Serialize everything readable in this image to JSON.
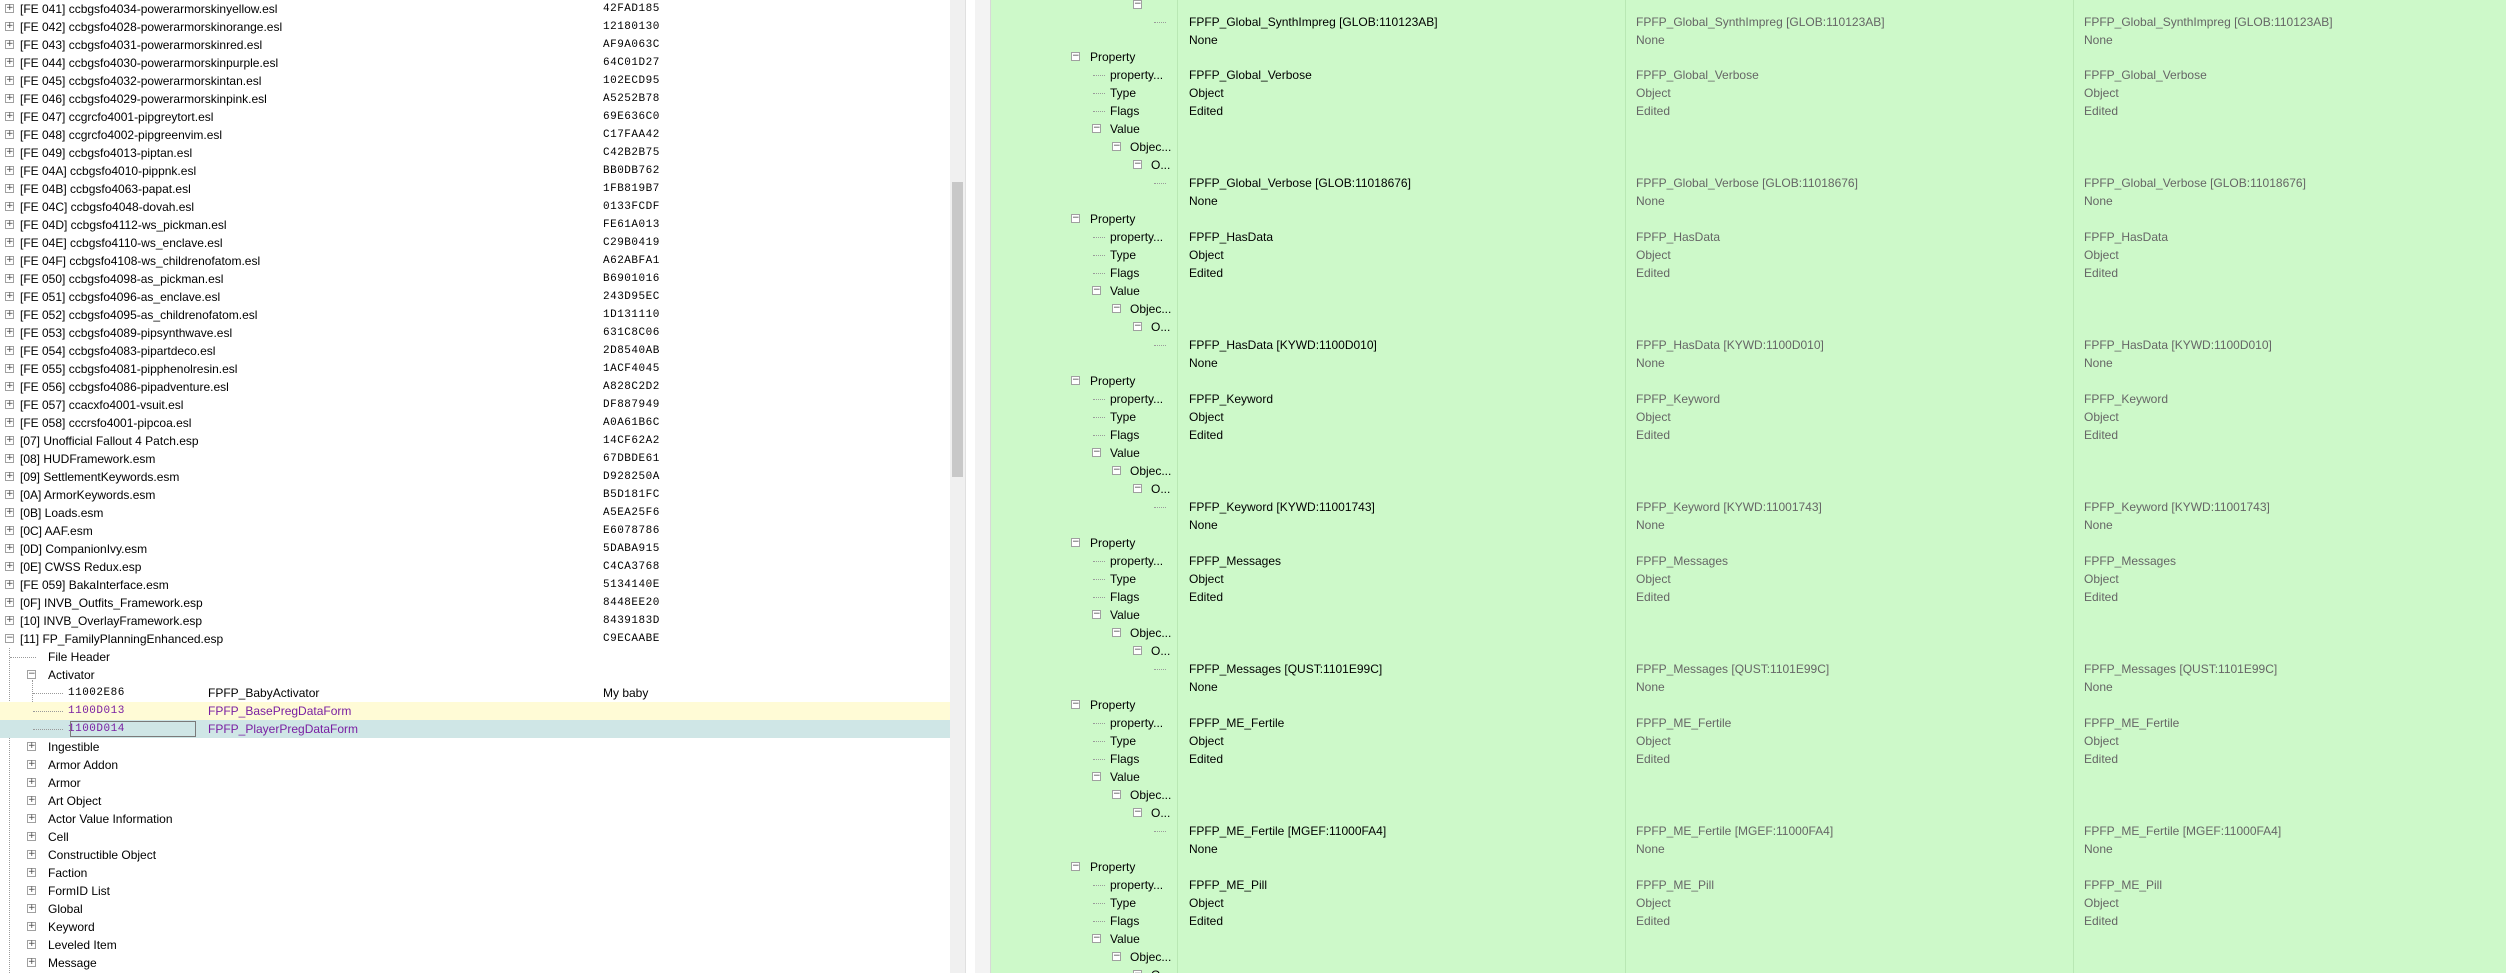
{
  "left_tree": {
    "plugins": [
      {
        "name": "[FE 041] ccbgsfo4034-powerarmorskinyellow.esl",
        "crc": "42FAD185"
      },
      {
        "name": "[FE 042] ccbgsfo4028-powerarmorskinorange.esl",
        "crc": "12180130"
      },
      {
        "name": "[FE 043] ccbgsfo4031-powerarmorskinred.esl",
        "crc": "AF9A063C"
      },
      {
        "name": "[FE 044] ccbgsfo4030-powerarmorskinpurple.esl",
        "crc": "64C01D27"
      },
      {
        "name": "[FE 045] ccbgsfo4032-powerarmorskintan.esl",
        "crc": "102ECD95"
      },
      {
        "name": "[FE 046] ccbgsfo4029-powerarmorskinpink.esl",
        "crc": "A5252B78"
      },
      {
        "name": "[FE 047] ccgrcfo4001-pipgreytort.esl",
        "crc": "69E636C0"
      },
      {
        "name": "[FE 048] ccgrcfo4002-pipgreenvim.esl",
        "crc": "C17FAA42"
      },
      {
        "name": "[FE 049] ccbgsfo4013-piptan.esl",
        "crc": "C42B2B75"
      },
      {
        "name": "[FE 04A] ccbgsfo4010-pippnk.esl",
        "crc": "BB0DB762"
      },
      {
        "name": "[FE 04B] ccbgsfo4063-papat.esl",
        "crc": "1FB819B7"
      },
      {
        "name": "[FE 04C] ccbgsfo4048-dovah.esl",
        "crc": "0133FCDF"
      },
      {
        "name": "[FE 04D] ccbgsfo4112-ws_pickman.esl",
        "crc": "FE61A013"
      },
      {
        "name": "[FE 04E] ccbgsfo4110-ws_enclave.esl",
        "crc": "C29B0419"
      },
      {
        "name": "[FE 04F] ccbgsfo4108-ws_childrenofatom.esl",
        "crc": "A62ABFA1"
      },
      {
        "name": "[FE 050] ccbgsfo4098-as_pickman.esl",
        "crc": "B6901016"
      },
      {
        "name": "[FE 051] ccbgsfo4096-as_enclave.esl",
        "crc": "243D95EC"
      },
      {
        "name": "[FE 052] ccbgsfo4095-as_childrenofatom.esl",
        "crc": "1D131110"
      },
      {
        "name": "[FE 053] ccbgsfo4089-pipsynthwave.esl",
        "crc": "631C8C06"
      },
      {
        "name": "[FE 054] ccbgsfo4083-pipartdeco.esl",
        "crc": "2D8540AB"
      },
      {
        "name": "[FE 055] ccbgsfo4081-pipphenolresin.esl",
        "crc": "1ACF4045"
      },
      {
        "name": "[FE 056] ccbgsfo4086-pipadventure.esl",
        "crc": "A828C2D2"
      },
      {
        "name": "[FE 057] ccacxfo4001-vsuit.esl",
        "crc": "DF887949"
      },
      {
        "name": "[FE 058] cccrsfo4001-pipcoa.esl",
        "crc": "A0A61B6C"
      },
      {
        "name": "[07] Unofficial Fallout 4 Patch.esp",
        "crc": "14CF62A2"
      },
      {
        "name": "[08] HUDFramework.esm",
        "crc": "67DBDE61"
      },
      {
        "name": "[09] SettlementKeywords.esm",
        "crc": "D928250A"
      },
      {
        "name": "[0A] ArmorKeywords.esm",
        "crc": "B5D181FC"
      },
      {
        "name": "[0B] Loads.esm",
        "crc": "A5EA25F6"
      },
      {
        "name": "[0C] AAF.esm",
        "crc": "E6078786"
      },
      {
        "name": "[0D] CompanionIvy.esm",
        "crc": "5DABA915"
      },
      {
        "name": "[0E] CWSS Redux.esp",
        "crc": "C4CA3768"
      },
      {
        "name": "[FE 059] BakaInterface.esm",
        "crc": "5134140E"
      },
      {
        "name": "[0F] INVB_Outfits_Framework.esp",
        "crc": "8448EE20"
      },
      {
        "name": "[10] INVB_OverlayFramework.esp",
        "crc": "8439183D"
      },
      {
        "name": "[11] FP_FamilyPlanningEnhanced.esp",
        "crc": "C9ECAABE"
      }
    ],
    "file_header": "File Header",
    "activator_group": "Activator",
    "activator_records": [
      {
        "formid": "11002E86",
        "editor_id": "FPFP_BabyActivator",
        "full_name": "My baby"
      },
      {
        "formid": "1100D013",
        "editor_id": "FPFP_BasePregDataForm",
        "full_name": ""
      },
      {
        "formid": "1100D014",
        "editor_id": "FPFP_PlayerPregDataForm",
        "full_name": ""
      }
    ],
    "groups": [
      "Ingestible",
      "Armor Addon",
      "Armor",
      "Art Object",
      "Actor Value Information",
      "Cell",
      "Constructible Object",
      "Faction",
      "FormID List",
      "Global",
      "Keyword",
      "Leveled Item",
      "Message"
    ]
  },
  "right_view": {
    "labels": {
      "property": "Property",
      "property_name": "property...",
      "type": "Type",
      "flags": "Flags",
      "value": "Value",
      "object_union": "Objec...",
      "object_v2": "O..."
    },
    "first_block": {
      "value": "FPFP_Global_SynthImpreg [GLOB:110123AB]",
      "none": "None"
    },
    "properties": [
      {
        "name": "FPFP_Global_Verbose",
        "type": "Object",
        "flags": "Edited",
        "value": "FPFP_Global_Verbose [GLOB:11018676]",
        "none": "None"
      },
      {
        "name": "FPFP_HasData",
        "type": "Object",
        "flags": "Edited",
        "value": "FPFP_HasData [KYWD:1100D010]",
        "none": "None"
      },
      {
        "name": "FPFP_Keyword",
        "type": "Object",
        "flags": "Edited",
        "value": "FPFP_Keyword [KYWD:11001743]",
        "none": "None"
      },
      {
        "name": "FPFP_Messages",
        "type": "Object",
        "flags": "Edited",
        "value": "FPFP_Messages [QUST:1101E99C]",
        "none": "None"
      },
      {
        "name": "FPFP_ME_Fertile",
        "type": "Object",
        "flags": "Edited",
        "value": "FPFP_ME_Fertile [MGEF:11000FA4]",
        "none": "None"
      },
      {
        "name": "FPFP_ME_Pill",
        "type": "Object",
        "flags": "Edited",
        "value": "",
        "none": ""
      }
    ]
  },
  "colors": {
    "left_bg": "#ffffff",
    "right_bg": "#cdf9c9",
    "selected_row": "#cfe6e6",
    "highlight_row": "#fffbd6",
    "formid": "#7a1fa2"
  }
}
